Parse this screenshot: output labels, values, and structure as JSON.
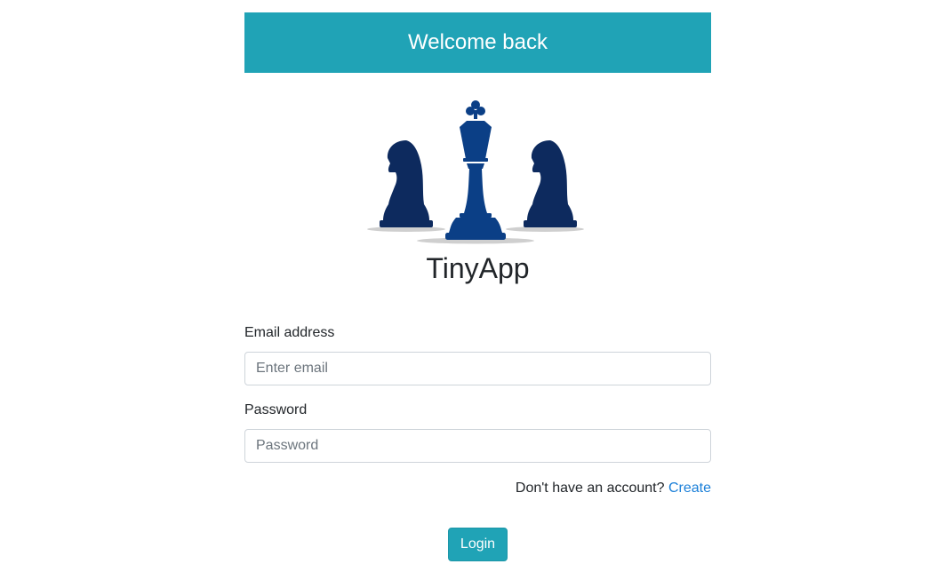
{
  "banner": {
    "title": "Welcome back"
  },
  "logo": {
    "icon": "chess-pieces-icon",
    "app_name": "TinyApp",
    "colors": {
      "knight": "#0d2a5e",
      "king": "#0b3f86",
      "shadow": "#cfcfcf"
    }
  },
  "form": {
    "email": {
      "label": "Email address",
      "placeholder": "Enter email",
      "value": ""
    },
    "password": {
      "label": "Password",
      "placeholder": "Password",
      "value": ""
    },
    "account_prompt": "Don't have an account?",
    "create_link": "Create",
    "login_label": "Login"
  },
  "colors": {
    "accent": "#20a3b6",
    "link": "#1a7fd8",
    "text": "#212529",
    "border": "#ced4da"
  }
}
